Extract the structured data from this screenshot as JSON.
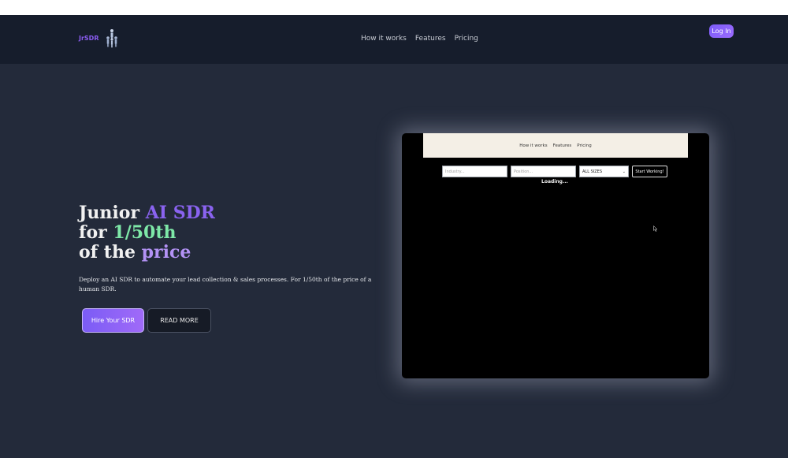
{
  "navbar": {
    "brand": "JrSDR",
    "links": [
      "How it works",
      "Features",
      "Pricing"
    ],
    "login_label": "Log In"
  },
  "hero": {
    "headline": {
      "line1_a": "Junior ",
      "line1_b": "AI SDR",
      "line2_a": "for ",
      "line2_b": "1/50th",
      "line3_a": "of the ",
      "line3_b": "price"
    },
    "subtext": "Deploy an AI SDR to automate your lead collection & sales processes. For 1/50th of the price of a human SDR.",
    "hire_label": "Hire Your SDR",
    "readmore_label": "READ MORE"
  },
  "preview": {
    "nav_links": [
      "How it works",
      "Features",
      "Pricing"
    ],
    "industry_placeholder": "Industry...",
    "position_placeholder": "Position...",
    "size_value": "ALL SIZES",
    "start_label": "Start Working!",
    "loading_text": "Loading..."
  },
  "colors": {
    "navbar_bg": "#161d2c",
    "hero_bg": "#232a3a",
    "accent_purple": "#8a63f0",
    "accent_green": "#7ee8a8"
  }
}
